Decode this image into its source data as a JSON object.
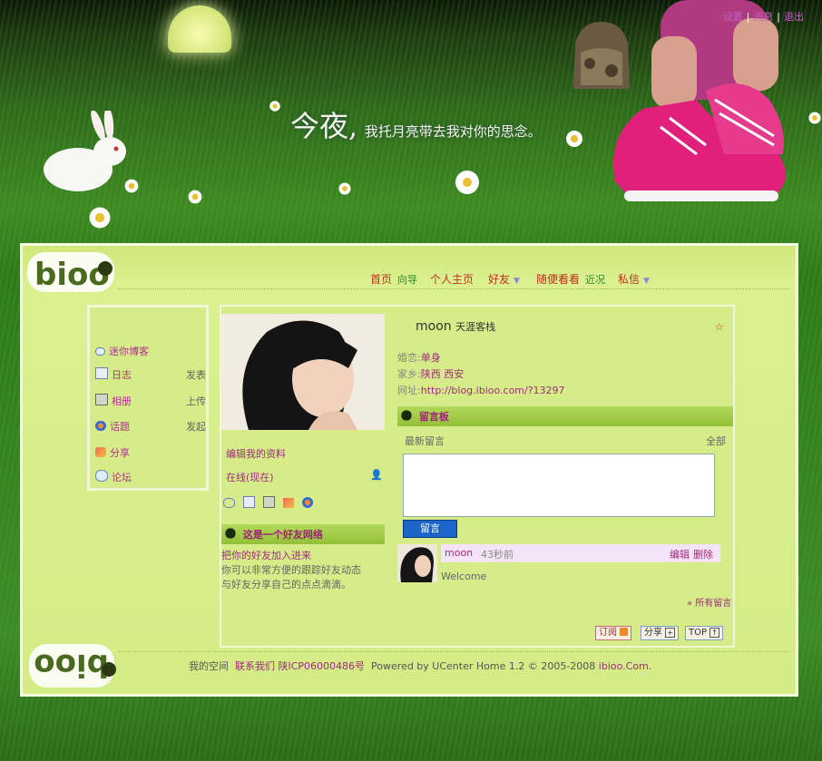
{
  "top_links": [
    "设置",
    "消息",
    "退出"
  ],
  "slogan": {
    "big": "今夜,",
    "small": "我托月亮带去我对你的思念。"
  },
  "nav": {
    "home": "首页",
    "guide": "向导",
    "profile": "个人主页",
    "friends": "好友",
    "random": "随便看看",
    "recent": "近况",
    "pm": "私信"
  },
  "sidebar": {
    "mini_blog": "迷你博客",
    "items": [
      {
        "label": "日志",
        "action": "发表"
      },
      {
        "label": "相册",
        "action": "上传"
      },
      {
        "label": "话题",
        "action": "发起"
      },
      {
        "label": "分享",
        "action": ""
      },
      {
        "label": "论坛",
        "action": ""
      }
    ]
  },
  "profile": {
    "name": "moon",
    "site_name": "天涯客栈",
    "marital_label": "婚恋:",
    "marital": "单身",
    "home_label": "家乡:",
    "home": "陕西 西安",
    "url_label": "网址:",
    "url": "http://blog.ibioo.com/?13297",
    "edit": "编辑我的资料",
    "status": "在线(现在)"
  },
  "friends_box": {
    "title": "这是一个好友网络",
    "invite": "把你的好友加入进来",
    "desc1": "你可以非常方便的跟踪好友动态",
    "desc2": "与好友分享自己的点点滴滴。"
  },
  "board": {
    "title": "留言板",
    "latest": "最新留言",
    "all": "全部",
    "submit": "留言",
    "comment": {
      "user": "moon",
      "time": "43秒前",
      "edit": "编辑",
      "delete": "删除",
      "text": "Welcome"
    },
    "all_messages": "» 所有留言"
  },
  "tools": {
    "subscribe": "订阅",
    "share": "分享",
    "top": "TOP"
  },
  "footer": {
    "myspace": "我的空间",
    "contact": "联系我们",
    "icp": "陕ICP06000486号",
    "powered": "Powered by UCenter Home 1.2 © 2005-2008",
    "site": "ibioo.Com."
  },
  "logo_text": "bioo",
  "colors": {
    "accent": "#a02a80",
    "nav_red": "#c03020",
    "bar_green": "#94c038",
    "btn_blue": "#1b64c8"
  }
}
